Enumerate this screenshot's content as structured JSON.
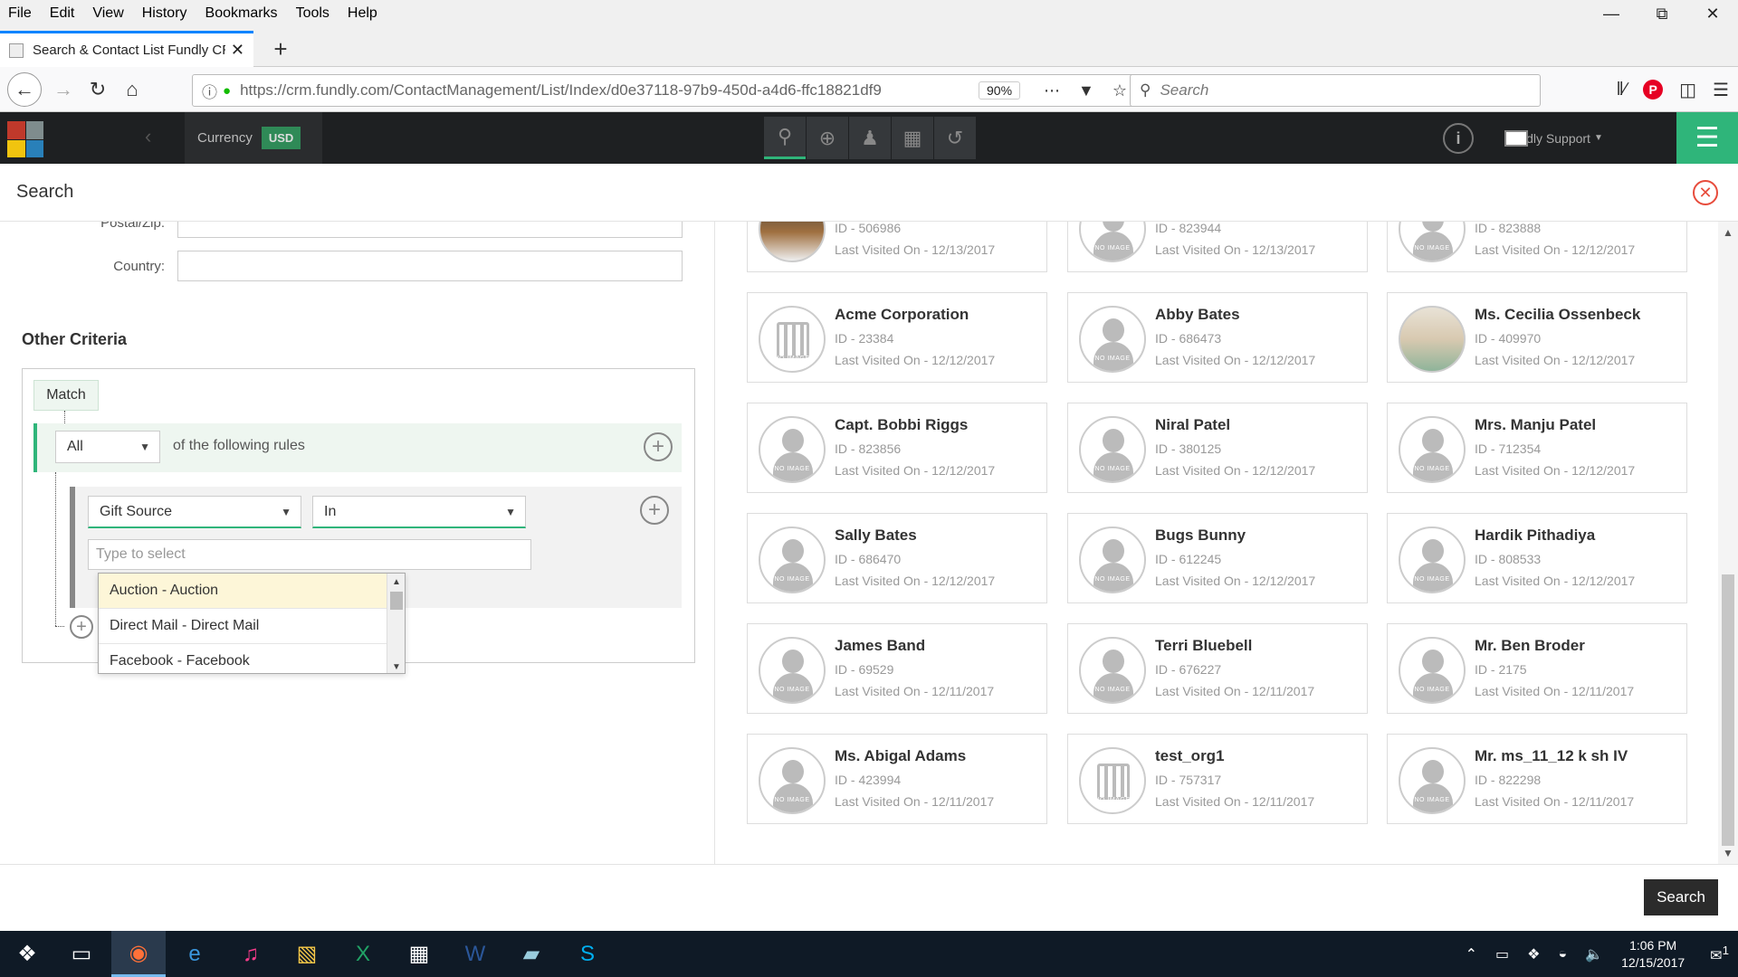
{
  "menubar": {
    "items": [
      "File",
      "Edit",
      "View",
      "History",
      "Bookmarks",
      "Tools",
      "Help"
    ]
  },
  "browser": {
    "tab_title": "Search & Contact List Fundly CRM",
    "url": "https://crm.fundly.com/ContactManagement/List/Index/d0e37118-97b9-450d-a4d6-ffc18821df9",
    "zoom": "90%",
    "search_placeholder": "Search"
  },
  "app_header": {
    "currency_label": "Currency",
    "currency_value": "USD",
    "user_name": "Fundly Support"
  },
  "search_panel": {
    "title": "Search",
    "postal_label": "Postal/Zip:",
    "country_label": "Country:",
    "other_criteria_title": "Other Criteria",
    "match_label": "Match",
    "match_value": "All",
    "of_rules_text": "of the following rules",
    "field_select": "Gift Source",
    "operator_select": "In",
    "type_placeholder": "Type to select",
    "dropdown_options": [
      "Auction - Auction",
      "Direct Mail - Direct Mail",
      "Facebook - Facebook"
    ],
    "search_button": "Search"
  },
  "contacts": [
    {
      "name": "",
      "id": "ID - 506986",
      "visited": "Last Visited On - 12/13/2017",
      "avatar": "photo2"
    },
    {
      "name": "",
      "id": "ID - 823944",
      "visited": "Last Visited On - 12/13/2017",
      "avatar": "person"
    },
    {
      "name": "",
      "id": "ID - 823888",
      "visited": "Last Visited On - 12/12/2017",
      "avatar": "person"
    },
    {
      "name": "Acme Corporation",
      "id": "ID - 23384",
      "visited": "Last Visited On - 12/12/2017",
      "avatar": "building"
    },
    {
      "name": "Abby Bates",
      "id": "ID - 686473",
      "visited": "Last Visited On - 12/12/2017",
      "avatar": "person"
    },
    {
      "name": "Ms. Cecilia Ossenbeck",
      "id": "ID - 409970",
      "visited": "Last Visited On - 12/12/2017",
      "avatar": "photo"
    },
    {
      "name": "Capt. Bobbi Riggs",
      "id": "ID - 823856",
      "visited": "Last Visited On - 12/12/2017",
      "avatar": "person"
    },
    {
      "name": "Niral Patel",
      "id": "ID - 380125",
      "visited": "Last Visited On - 12/12/2017",
      "avatar": "person"
    },
    {
      "name": "Mrs. Manju Patel",
      "id": "ID - 712354",
      "visited": "Last Visited On - 12/12/2017",
      "avatar": "person"
    },
    {
      "name": "Sally Bates",
      "id": "ID - 686470",
      "visited": "Last Visited On - 12/12/2017",
      "avatar": "person"
    },
    {
      "name": "Bugs Bunny",
      "id": "ID - 612245",
      "visited": "Last Visited On - 12/12/2017",
      "avatar": "person"
    },
    {
      "name": "Hardik Pithadiya",
      "id": "ID - 808533",
      "visited": "Last Visited On - 12/12/2017",
      "avatar": "person"
    },
    {
      "name": "James Band",
      "id": "ID - 69529",
      "visited": "Last Visited On - 12/11/2017",
      "avatar": "person"
    },
    {
      "name": "Terri Bluebell",
      "id": "ID - 676227",
      "visited": "Last Visited On - 12/11/2017",
      "avatar": "person"
    },
    {
      "name": "Mr. Ben Broder",
      "id": "ID - 2175",
      "visited": "Last Visited On - 12/11/2017",
      "avatar": "person"
    },
    {
      "name": "Ms. Abigal Adams",
      "id": "ID - 423994",
      "visited": "Last Visited On - 12/11/2017",
      "avatar": "person"
    },
    {
      "name": "test_org1",
      "id": "ID - 757317",
      "visited": "Last Visited On - 12/11/2017",
      "avatar": "building"
    },
    {
      "name": "Mr. ms_11_12 k sh IV",
      "id": "ID - 822298",
      "visited": "Last Visited On - 12/11/2017",
      "avatar": "person"
    }
  ],
  "avatar_placeholder_text": "NO IMAGE",
  "taskbar": {
    "time": "1:06 PM",
    "date": "12/15/2017",
    "notification_count": "1"
  },
  "colors": {
    "accent_green": "#2fb57a",
    "header_dark": "#1e2022",
    "close_red": "#e74c3c"
  }
}
